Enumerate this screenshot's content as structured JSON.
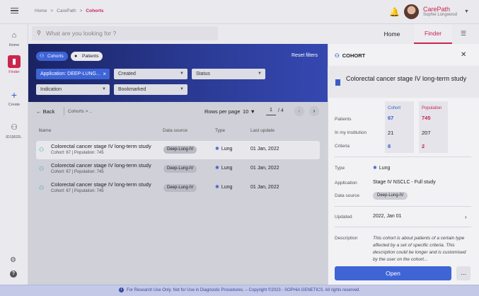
{
  "breadcrumb": {
    "items": [
      "Home",
      "CarePath"
    ],
    "current": "Cohorts",
    "sep": ">"
  },
  "user": {
    "app": "CarePath",
    "name": "Sophie Longwood"
  },
  "rail": {
    "home": "Home",
    "finder": "Finder",
    "create": "Create",
    "id": "ID19029.."
  },
  "search": {
    "placeholder": "What are you looking for ?"
  },
  "tabs": {
    "home": "Home",
    "finder": "Finder"
  },
  "filters": {
    "seg_cohorts": "Cohorts",
    "seg_patients": "Patients",
    "reset": "Reset filters",
    "application": "Application: DEEP-LUNG...",
    "created": "Created",
    "status": "Status",
    "indication": "Indication",
    "bookmarked": "Bookmarked"
  },
  "list": {
    "back": "Back",
    "crumb": "Cohorts  >  ..",
    "rows_per_page_label": "Rows per page",
    "rows_per_page": "10",
    "page": "1",
    "page_total": "/ 4",
    "headers": {
      "name": "Name",
      "source": "Data source",
      "type": "Type",
      "updated": "Last update"
    },
    "rows": [
      {
        "title": "Colorectal cancer stage IV long-term study",
        "sub": "Cohort: 67  |  Population: 745",
        "source": "Deep-Lung-IV",
        "type": "Lung",
        "date": "01 Jan, 2022"
      },
      {
        "title": "Colorectal cancer stage IV long-term study",
        "sub": "Cohort: 67  |  Population: 745",
        "source": "Deep-Lung-IV",
        "type": "Lung",
        "date": "01 Jan, 2022"
      },
      {
        "title": "Colorectal cancer stage IV long-term study",
        "sub": "Cohort: 67  |  Population: 745",
        "source": "Deep-Lung-IV",
        "type": "Lung",
        "date": "01 Jan, 2022"
      }
    ]
  },
  "panel": {
    "header": "COHORT",
    "title": "Colorectal cancer stage IV long-term study",
    "col_cohort": "Cohort",
    "col_population": "Population",
    "stats": [
      {
        "label": "Patients",
        "cohort": "67",
        "population": "745"
      },
      {
        "label": "In my institution",
        "cohort": "21",
        "population": "207"
      },
      {
        "label": "Criteria",
        "cohort": "8",
        "population": "2"
      }
    ],
    "type_label": "Type",
    "type_value": "Lung",
    "application_label": "Application",
    "application_value": "Stage IV NSCLC - Full study",
    "source_label": "Data source",
    "source_value": "Deep-Lung-IV",
    "updated_label": "Updated",
    "updated_value": "2022, Jan 01",
    "description_label": "Description",
    "description_value": "This cohort is about patients of a certain type affected by a set of  specific criteria. This description could be longer and is customised by the user on the cohort...",
    "open": "Open",
    "more": "..."
  },
  "footer": {
    "text": "For Research Use Only. Not for Use in Diagnostic Procedures.  –  Copyright ©2023 - SOPHiA GENETICS. All rights reserved."
  },
  "colors": {
    "brand": "#c8264c",
    "accent": "#3e64d6",
    "banner": "#1a2362"
  }
}
